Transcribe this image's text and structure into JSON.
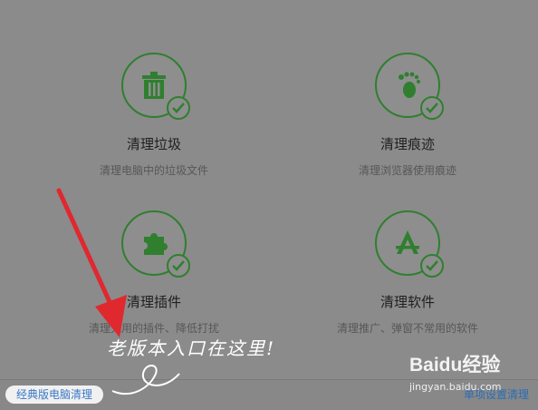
{
  "cards": [
    {
      "title": "清理垃圾",
      "description": "清理电脑中的垃圾文件",
      "icon": "trash-icon"
    },
    {
      "title": "清理痕迹",
      "description": "清理浏览器使用痕迹",
      "icon": "footprint-icon"
    },
    {
      "title": "清理插件",
      "description": "清理无用的插件、降低打扰",
      "icon": "puzzle-icon"
    },
    {
      "title": "清理软件",
      "description": "清理推广、弹窗不常用的软件",
      "icon": "app-store-icon"
    }
  ],
  "bottom": {
    "classic_button": "经典版电脑清理",
    "right_link": "单项设置清理"
  },
  "annotation": {
    "text": "老版本入口在这里!"
  },
  "watermark": {
    "brand": "Baidu经验",
    "url": "jingyan.baidu.com"
  },
  "colors": {
    "accent_green": "#2f7f2f",
    "annotation_arrow": "#e0282f",
    "link_blue": "#2a6db4"
  }
}
